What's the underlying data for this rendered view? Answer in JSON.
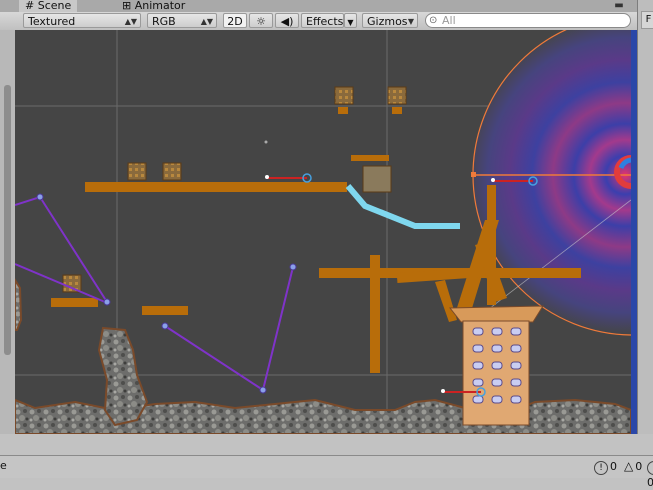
{
  "tabs": [
    {
      "icon": "grid-icon",
      "label": "Scene",
      "active": true
    },
    {
      "icon": "animator-icon",
      "label": "Animator",
      "active": false
    }
  ],
  "toolbar": {
    "shading_mode": "Textured",
    "render_mode": "RGB",
    "mode_2d": "2D",
    "lighting_icon": "sun-icon",
    "audio_icon": "speaker-icon",
    "effects_label": "Effects",
    "gizmos_label": "Gizmos",
    "search_placeholder": "All"
  },
  "right_panel": {
    "tab_label": "F"
  },
  "status": {
    "left_text": "e",
    "error_count": "0",
    "warning_count": "0",
    "info_count": "0"
  },
  "colors": {
    "scene_bg": "#454545",
    "platform": "#b86d0a",
    "joint": "#7f33c9",
    "ice": "#7fd7ee",
    "radius": "#f07a3a"
  }
}
